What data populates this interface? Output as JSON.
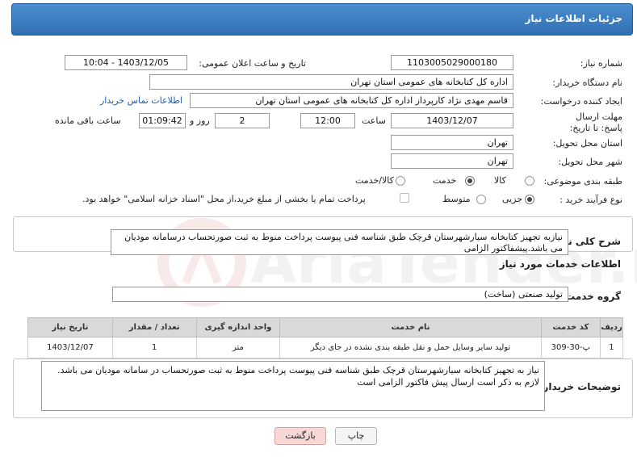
{
  "header": {
    "title": "جزئیات اطلاعات نیاز"
  },
  "watermark": {
    "text": "AriaTender.neT"
  },
  "form": {
    "need_number": {
      "label": "شماره نیاز:",
      "value": "1103005029000180"
    },
    "announce_datetime": {
      "label": "تاریخ و ساعت اعلان عمومی:",
      "value": "1403/12/05 - 10:04"
    },
    "buyer_org": {
      "label": "نام دستگاه خریدار:",
      "value": "اداره کل کتابخانه های عمومی استان تهران"
    },
    "creator": {
      "label": "ایجاد کننده درخواست:",
      "value": "قاسم مهدی نژاد کارپرداز اداره کل کتابخانه های عمومی استان تهران",
      "contact_link": "اطلاعات تماس خریدار"
    },
    "deadline": {
      "label": "مهلت ارسال پاسخ: تا تاریخ:",
      "date": "1403/12/07",
      "time_label": "ساعت",
      "time": "12:00",
      "days": "2",
      "days_label": "روز و",
      "remaining": "01:09:42",
      "remaining_label": "ساعت باقی مانده"
    },
    "delivery_province": {
      "label": "استان محل تحویل:",
      "value": "تهران"
    },
    "delivery_city": {
      "label": "شهر محل تحویل:",
      "value": "تهران"
    },
    "category": {
      "label": "طبقه بندی موضوعی:",
      "options": [
        "کالا",
        "خدمت",
        "کالا/خدمت"
      ],
      "selected": "خدمت"
    },
    "process_type": {
      "label": "نوع فرآیند خرید :",
      "options": [
        "جزیی",
        "متوسط"
      ],
      "selected": "جزیی",
      "payment_note": "پرداخت تمام یا بخشی از مبلغ خرید،از محل \"اسناد خزانه اسلامی\" خواهد بود."
    }
  },
  "summary": {
    "label": "شرح کلی نیاز:",
    "text": "نیازبه تجهیز کتابخانه سیارشهرستان قرچک طبق شناسه فنی پیوست پرداخت منوط به ثبت صورتحساب درسامانه مودیان می باشد.پیشفاکتور الزامی"
  },
  "services_section": {
    "title": "اطلاعات خدمات مورد نیاز",
    "group_label": "گروه خدمت:",
    "group_value": "تولید صنعتی (ساخت)",
    "table": {
      "headers": [
        "ردیف",
        "کد خدمت",
        "نام خدمت",
        "واحد اندازه گیری",
        "تعداد / مقدار",
        "تاریخ نیاز"
      ],
      "rows": [
        [
          "1",
          "پ-30-309",
          "تولید سایر وسایل حمل و نقل طبقه بندی نشده در جای دیگر",
          "متر",
          "1",
          "1403/12/07"
        ]
      ]
    }
  },
  "buyer_notes": {
    "label": "توضیحات خریدار:",
    "text": "نیاز به تجهیز کتابخانه سیارشهرستان قرچک طبق شناسه فنی پیوست پرداخت منوط به ثبت صورتحساب در سامانه مودیان می باشد. لازم به ذکر است ارسال پیش فاکتور الزامی است"
  },
  "buttons": {
    "print": "چاپ",
    "back": "بازگشت"
  },
  "colors": {
    "header_bg": "#3b7dc0",
    "link": "#1c5fb0",
    "back_btn_bg": "#f8d7d7"
  }
}
